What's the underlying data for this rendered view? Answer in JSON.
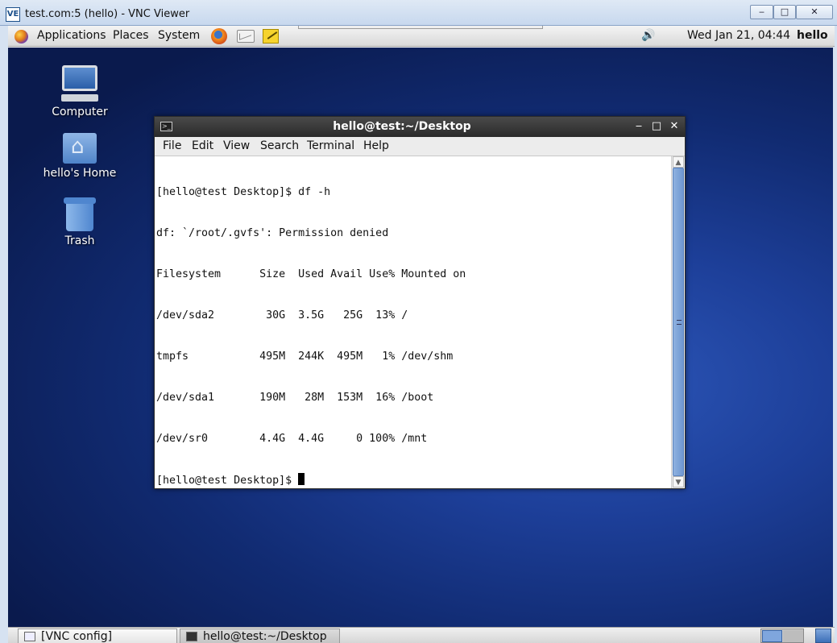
{
  "vnc": {
    "title": "test.com:5 (hello) - VNC Viewer",
    "logo": "VE",
    "minimize": "‒",
    "maximize": "□",
    "close": "✕"
  },
  "top_panel": {
    "menus": [
      "Applications",
      "Places",
      "System"
    ],
    "icons": [
      "applications-icon",
      "firefox-icon",
      "mail-icon",
      "notes-icon",
      "volume-icon"
    ],
    "clock": "Wed Jan 21, 04:44",
    "user": "hello"
  },
  "desktop_icons": [
    {
      "label": "Computer",
      "icon": "computer-icon"
    },
    {
      "label": "hello's Home",
      "icon": "home-folder-icon"
    },
    {
      "label": "Trash",
      "icon": "trash-icon"
    }
  ],
  "terminal": {
    "title": "hello@test:~/Desktop",
    "menus": [
      "File",
      "Edit",
      "View",
      "Search",
      "Terminal",
      "Help"
    ],
    "lines": [
      "[hello@test Desktop]$ df -h",
      "df: `/root/.gvfs': Permission denied",
      "Filesystem      Size  Used Avail Use% Mounted on",
      "/dev/sda2        30G  3.5G   25G  13% /",
      "tmpfs           495M  244K  495M   1% /dev/shm",
      "/dev/sda1       190M   28M  153M  16% /boot",
      "/dev/sr0        4.4G  4.4G     0 100% /mnt"
    ],
    "prompt": "[hello@test Desktop]$ "
  },
  "taskbar": {
    "tasks": [
      "[VNC config]",
      "hello@test:~/Desktop"
    ]
  },
  "colors": {
    "desktop": "#1d3f99",
    "scroll_thumb": "#6f97d1",
    "terminal_titlebar": "#2a2a2a"
  }
}
